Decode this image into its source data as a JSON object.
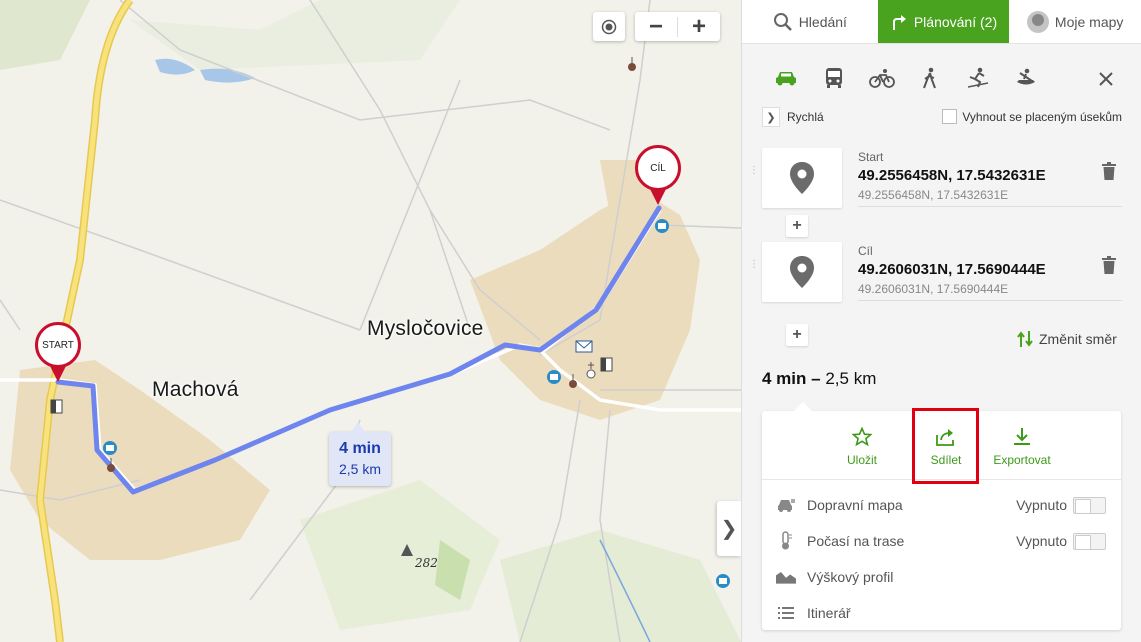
{
  "map": {
    "labels": {
      "village1": "Machová",
      "village2": "Mysločovice",
      "elevation": "282"
    },
    "pins": {
      "start": "START",
      "end": "CÍL"
    },
    "route_bubble": {
      "time": "4 min",
      "distance": "2,5 km"
    },
    "controls": {
      "zoom_out": "−",
      "zoom_in": "+",
      "collapse": "❯"
    }
  },
  "tabs": {
    "search": "Hledání",
    "planning": "Plánování (2)",
    "my_maps": "Moje mapy"
  },
  "transport_modes": [
    "car-icon",
    "bus-icon",
    "bike-icon",
    "walk-icon",
    "ski-icon",
    "boat-icon"
  ],
  "options": {
    "route_type": "Rychlá",
    "avoid_tolls": "Vyhnout se placeným úsekům"
  },
  "waypoints": [
    {
      "label": "Start",
      "coords": "49.2556458N, 17.5432631E",
      "sub": "49.2556458N, 17.5432631E"
    },
    {
      "label": "Cíl",
      "coords": "49.2606031N, 17.5690444E",
      "sub": "49.2606031N, 17.5690444E"
    }
  ],
  "reverse": "Změnit směr",
  "summary": {
    "time": "4 min",
    "dash": "–",
    "distance": "2,5 km"
  },
  "actions": {
    "save": "Uložit",
    "share": "Sdílet",
    "export": "Exportovat"
  },
  "layers": [
    {
      "label": "Dopravní mapa",
      "state": "Vypnuto",
      "icon": "traffic-icon"
    },
    {
      "label": "Počasí na trase",
      "state": "Vypnuto",
      "icon": "thermometer-icon"
    },
    {
      "label": "Výškový profil",
      "icon": "elevation-profile-icon"
    },
    {
      "label": "Itinerář",
      "icon": "list-icon"
    }
  ],
  "colors": {
    "accent": "#49a31f",
    "route": "#6f85ee",
    "pin": "#c8102e",
    "highlight": "#e0000f"
  }
}
